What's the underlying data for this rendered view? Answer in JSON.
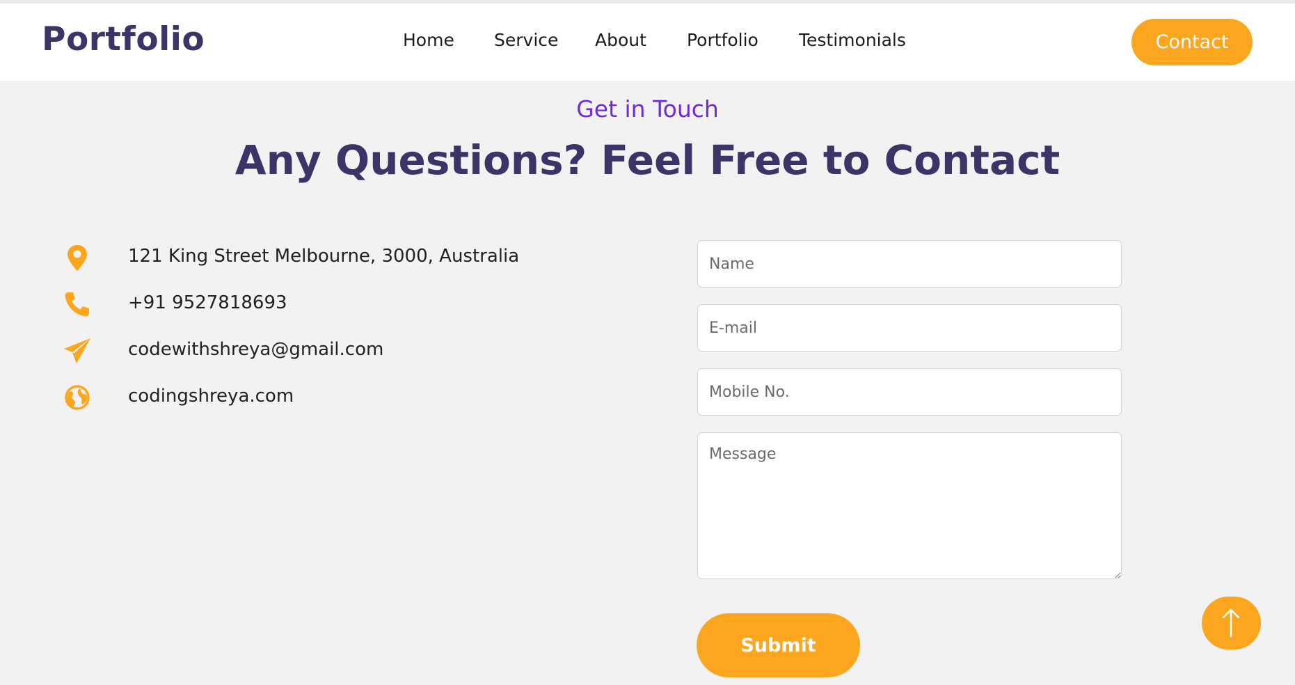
{
  "brand": {
    "logo": "Portfolio"
  },
  "nav": {
    "items": [
      {
        "label": "Home"
      },
      {
        "label": "Service"
      },
      {
        "label": "About"
      },
      {
        "label": "Portfolio"
      },
      {
        "label": "Testimonials"
      }
    ],
    "contact_button": "Contact"
  },
  "section": {
    "eyebrow": "Get in Touch",
    "title": "Any Questions? Feel Free to Contact"
  },
  "info": [
    {
      "icon": "location-pin-icon",
      "text": "121 King Street Melbourne, 3000, Australia"
    },
    {
      "icon": "phone-icon",
      "text": "+91 9527818693"
    },
    {
      "icon": "paper-plane-icon",
      "text": "codewithshreya@gmail.com"
    },
    {
      "icon": "globe-icon",
      "text": "codingshreya.com"
    }
  ],
  "form": {
    "name_placeholder": "Name",
    "email_placeholder": "E-mail",
    "mobile_placeholder": "Mobile No.",
    "message_placeholder": "Message",
    "submit_label": "Submit"
  },
  "scroll_top": {
    "icon": "arrow-up-icon"
  },
  "colors": {
    "accent": "#fca61f",
    "brand": "#3b3466",
    "eyebrow": "#6d2ae2",
    "background": "#f2f2f2"
  }
}
